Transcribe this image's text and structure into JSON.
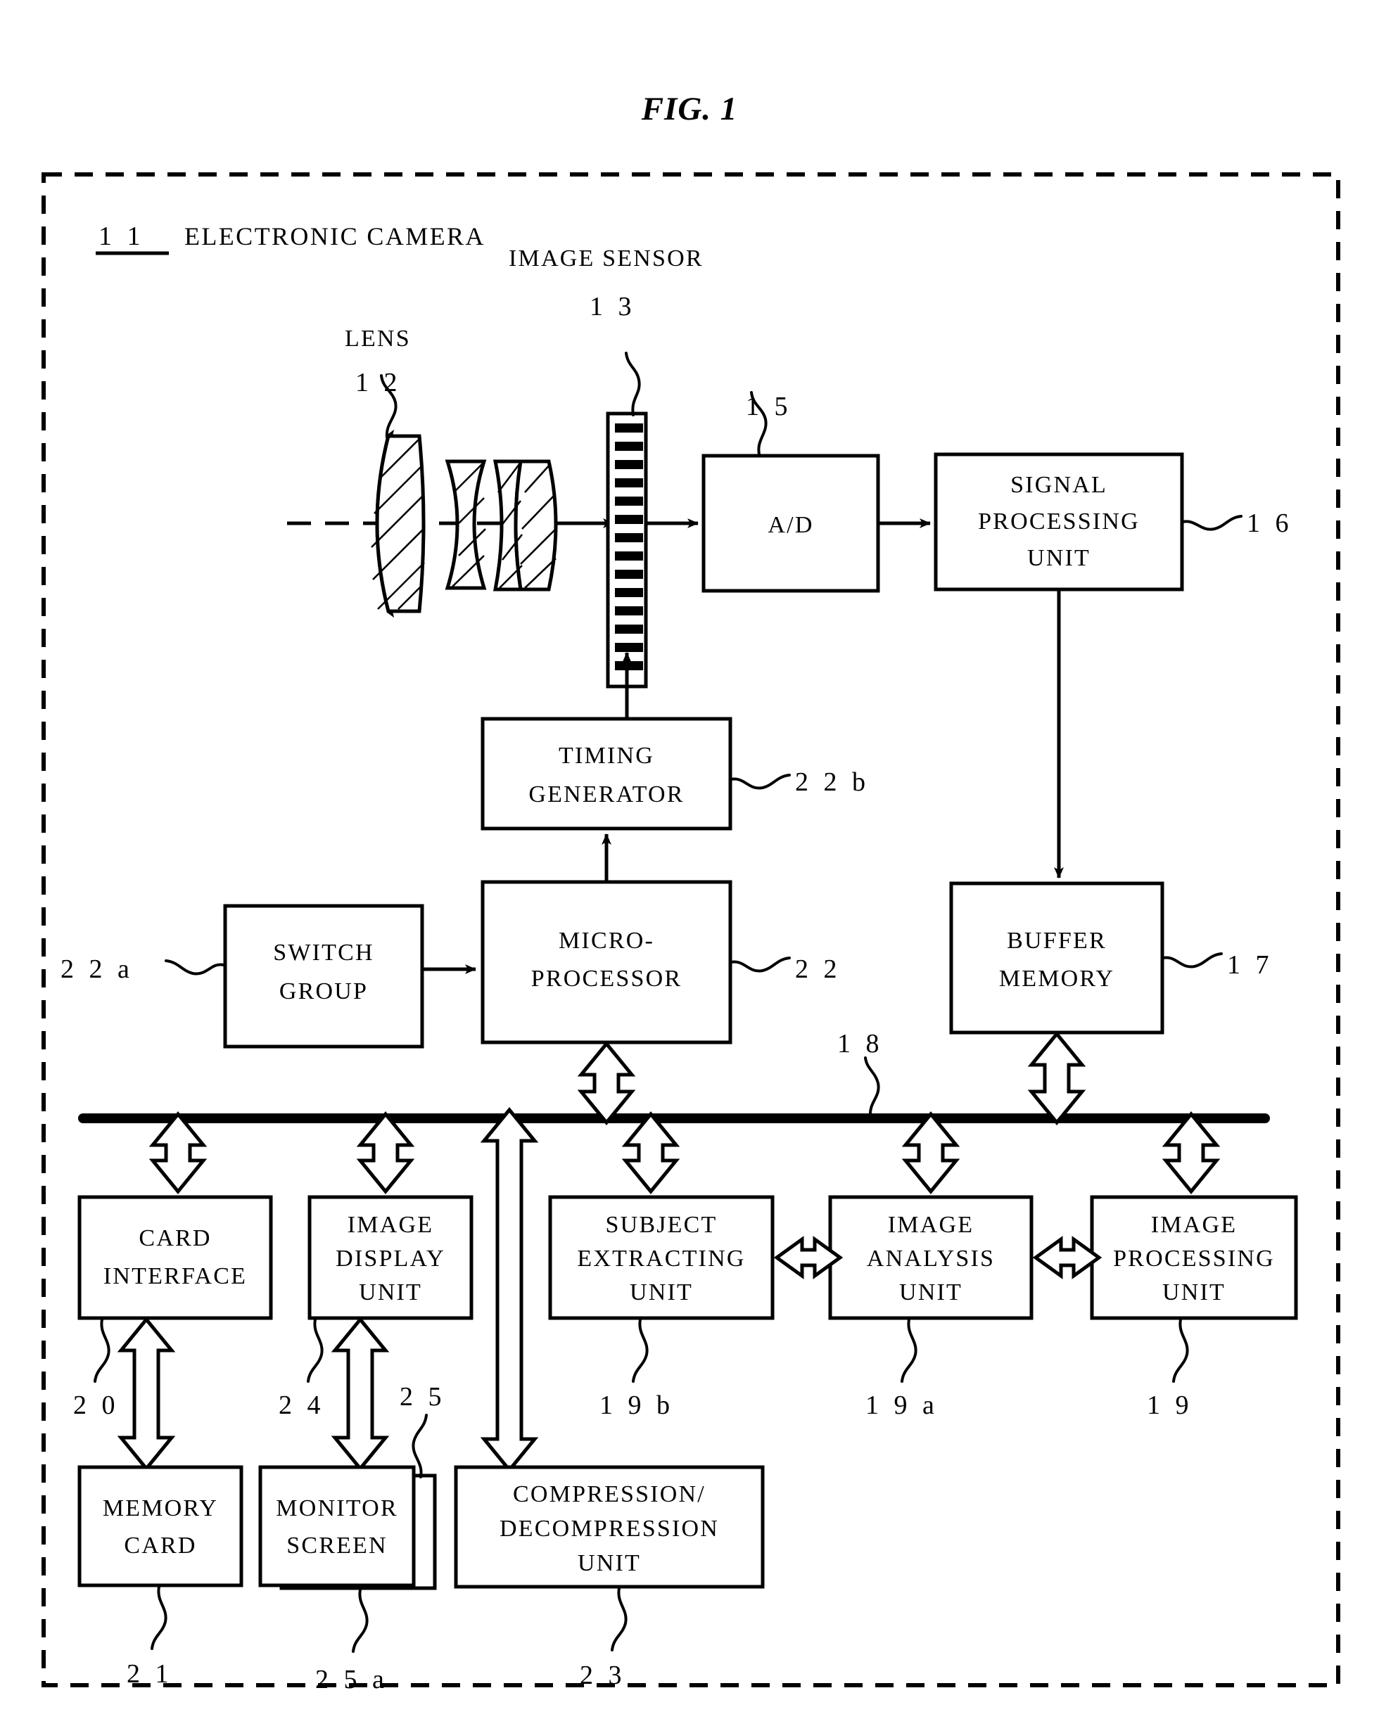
{
  "figure": {
    "title": "FIG. 1",
    "outer_label_number": "1 1",
    "outer_label_text": "ELECTRONIC CAMERA"
  },
  "optics": {
    "lens_label": "LENS",
    "lens_number": "1 2",
    "sensor_label": "IMAGE SENSOR",
    "sensor_number": "1 3"
  },
  "blocks": {
    "ad": {
      "lines": [
        "A/D"
      ],
      "number": "1 5"
    },
    "signal_processing": {
      "lines": [
        "SIGNAL",
        "PROCESSING",
        "UNIT"
      ],
      "number": "1 6"
    },
    "timing_generator": {
      "lines": [
        "TIMING",
        "GENERATOR"
      ],
      "number": "2 2 b"
    },
    "switch_group": {
      "lines": [
        "SWITCH",
        "GROUP"
      ],
      "number": "2 2 a"
    },
    "microprocessor": {
      "lines": [
        "MICRO-",
        "PROCESSOR"
      ],
      "number": "2 2"
    },
    "buffer_memory": {
      "lines": [
        "BUFFER",
        "MEMORY"
      ],
      "number": "1 7"
    },
    "bus": {
      "number": "1 8"
    },
    "card_interface": {
      "lines": [
        "CARD",
        "INTERFACE"
      ],
      "number": "2 0"
    },
    "image_display_unit": {
      "lines": [
        "IMAGE",
        "DISPLAY",
        "UNIT"
      ],
      "number": "2 4"
    },
    "subject_extracting_unit": {
      "lines": [
        "SUBJECT",
        "EXTRACTING",
        "UNIT"
      ],
      "number": "1 9 b"
    },
    "image_analysis_unit": {
      "lines": [
        "IMAGE",
        "ANALYSIS",
        "UNIT"
      ],
      "number": "1 9 a"
    },
    "image_processing_unit": {
      "lines": [
        "IMAGE",
        "PROCESSING",
        "UNIT"
      ],
      "number": "1 9"
    },
    "memory_card": {
      "lines": [
        "MEMORY",
        "CARD"
      ],
      "number": "2 1"
    },
    "monitor_screen": {
      "lines": [
        "MONITOR",
        "SCREEN"
      ],
      "number": "2 5",
      "back_number": "2 5 a"
    },
    "compression_unit": {
      "lines": [
        "COMPRESSION/",
        "DECOMPRESSION",
        "UNIT"
      ],
      "number": "2 3"
    }
  },
  "style": {
    "ink": "#000000",
    "paper": "#ffffff"
  }
}
